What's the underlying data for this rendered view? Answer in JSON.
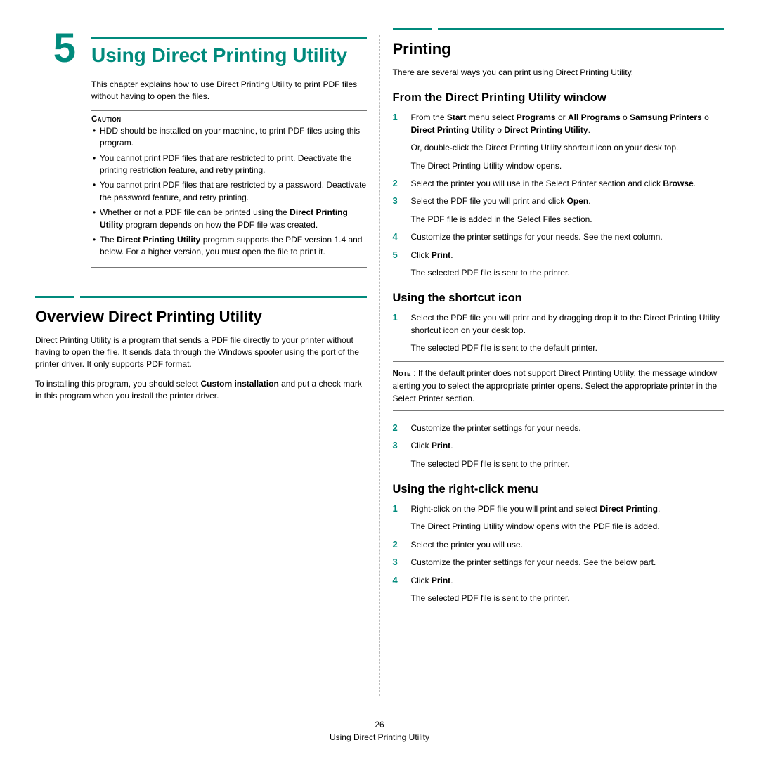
{
  "chapter": {
    "num": "5",
    "title": "Using Direct Printing Utility"
  },
  "intro": "This chapter explains how to use Direct Printing Utility to print PDF files without having to open the files.",
  "caution": {
    "label": "Caution",
    "items": [
      "HDD should be installed on your machine, to print PDF files using this program.",
      "You cannot print PDF files that are restricted to print. Deactivate the printing restriction feature, and retry printing.",
      "You cannot print PDF files that are restricted by a password. Deactivate the password feature, and retry printing.",
      "Whether or not a PDF file can be printed using the <b>Direct Printing Utility</b> program depends on how the PDF file was created.",
      "The <b>Direct Printing Utility</b> program supports the PDF version 1.4 and below. For a higher version, you must open the file to print it."
    ]
  },
  "overview": {
    "heading": "Overview Direct Printing Utility",
    "p1": "Direct Printing Utility is a program that sends a PDF file directly to your printer without having to open the file. It sends data through the Windows spooler using the port of the printer driver. It only supports PDF format.",
    "p2": "To installing this program, you should select <b>Custom installation</b> and put a check mark in this program when you install the printer driver."
  },
  "printing": {
    "heading": "Printing",
    "intro": "There are several ways you can print using Direct Printing Utility.",
    "sub1": {
      "heading": "From the Direct Printing Utility window",
      "steps": [
        "From the <b>Start</b> menu select <b>Programs</b> or <b>All Programs</b> <span class='arrow'>o</span> <b>Samsung Printers</b> <span class='arrow'>o</span> <b>Direct Printing Utility</b> <span class='arrow'>o</span> <b>Direct Printing Utility</b>.<p>Or, double-click the Direct Printing Utility shortcut icon on your desk top.</p><p>The Direct Printing Utility window opens.</p>",
        "Select the printer you will use in the Select Printer section and click <b>Browse</b>.",
        "Select the PDF file you will print and click <b>Open</b>.<p>The PDF file is added in the Select Files section.</p>",
        "Customize the printer settings for your needs. See the next column.",
        "Click <b>Print</b>.<p>The selected PDF file is sent to the printer.</p>"
      ]
    },
    "sub2": {
      "heading": "Using the shortcut icon",
      "steps_a": [
        "Select the PDF file you will print and by dragging drop it to the Direct Printing Utility shortcut icon on your desk top.<p>The selected PDF file is sent to the default printer.</p>"
      ],
      "note_label": "Note",
      "note": "If the default printer does not support Direct Printing Utility, the message window alerting you to select the appropriate printer opens. Select the appropriate printer in the Select Printer section.",
      "steps_b_start": 2,
      "steps_b": [
        "Customize the printer settings for your needs.",
        "Click <b>Print</b>.<p>The selected PDF file is sent to the printer.</p>"
      ]
    },
    "sub3": {
      "heading": "Using the right-click menu",
      "steps": [
        "Right-click on the PDF file you will print and select <b>Direct Printing</b>.<p>The Direct Printing Utility window opens with the PDF file is added.</p>",
        "Select the printer you will use.",
        "Customize the printer settings for your needs. See the below part.",
        "Click <b>Print</b>.<p>The selected PDF file is sent to the printer.</p>"
      ]
    }
  },
  "footer": {
    "page": "26",
    "title": "Using Direct Printing Utility"
  }
}
